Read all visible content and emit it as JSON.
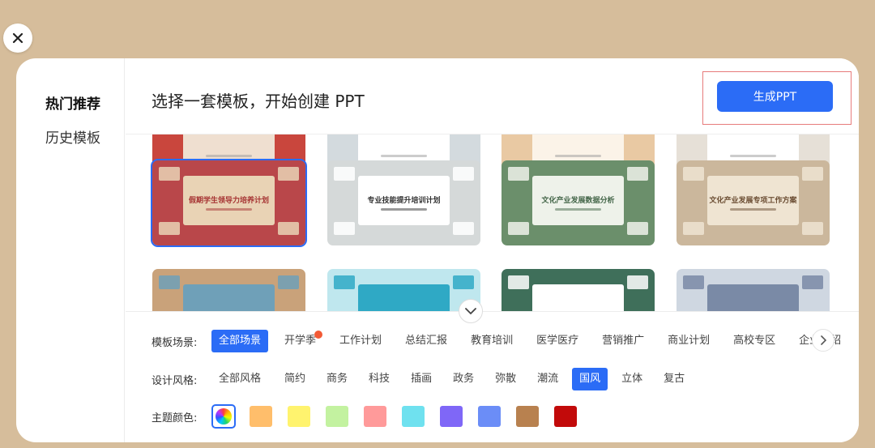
{
  "sidebar": {
    "items": [
      {
        "label": "热门推荐",
        "active": true
      },
      {
        "label": "历史模板",
        "active": false
      }
    ]
  },
  "header": {
    "title": "选择一套模板，开始创建 PPT",
    "generate_label": "生成PPT"
  },
  "templates": {
    "row_top": [
      {
        "bg": "#c9463d",
        "accent": "#efdfd0",
        "title": ""
      },
      {
        "bg": "#d3dade",
        "accent": "#ffffff",
        "title": ""
      },
      {
        "bg": "#e9c9a3",
        "accent": "#fbf3e8",
        "title": ""
      },
      {
        "bg": "#e6e0d7",
        "accent": "#ffffff",
        "title": ""
      }
    ],
    "row_main": [
      {
        "bg": "#b9474a",
        "accent": "#e9d3b5",
        "title": "假期学生领导力培养计划",
        "title_color": "#a63433",
        "selected": true
      },
      {
        "bg": "#d5d9d9",
        "accent": "#ffffff",
        "title": "专业技能提升培训计划",
        "title_color": "#333333",
        "selected": false
      },
      {
        "bg": "#6b8f6b",
        "accent": "#eef2ea",
        "title": "文化产业发展数据分析",
        "title_color": "#45674a",
        "selected": false
      },
      {
        "bg": "#cbb79c",
        "accent": "#efe4d2",
        "title": "文化产业发展专项工作方案",
        "title_color": "#6b4d33",
        "selected": false
      }
    ],
    "row_bottom": [
      {
        "bg": "#c9a27a",
        "accent": "#6fa0b8",
        "title": ""
      },
      {
        "bg": "#bfe7ee",
        "accent": "#2fa9c5",
        "title": ""
      },
      {
        "bg": "#3f6f5a",
        "accent": "#ffffff",
        "title": ""
      },
      {
        "bg": "#cfd7e1",
        "accent": "#7a8aa6",
        "title": ""
      }
    ]
  },
  "filters": {
    "scene": {
      "label": "模板场景:",
      "options": [
        {
          "label": "全部场景",
          "active": true,
          "hot": false
        },
        {
          "label": "开学季",
          "active": false,
          "hot": true
        },
        {
          "label": "工作计划",
          "active": false,
          "hot": false
        },
        {
          "label": "总结汇报",
          "active": false,
          "hot": false
        },
        {
          "label": "教育培训",
          "active": false,
          "hot": false
        },
        {
          "label": "医学医疗",
          "active": false,
          "hot": false
        },
        {
          "label": "营销推广",
          "active": false,
          "hot": false
        },
        {
          "label": "商业计划",
          "active": false,
          "hot": false
        },
        {
          "label": "高校专区",
          "active": false,
          "hot": false
        },
        {
          "label": "企业介绍",
          "active": false,
          "hot": false
        }
      ]
    },
    "style": {
      "label": "设计风格:",
      "options": [
        {
          "label": "全部风格",
          "active": false
        },
        {
          "label": "简约",
          "active": false
        },
        {
          "label": "商务",
          "active": false
        },
        {
          "label": "科技",
          "active": false
        },
        {
          "label": "插画",
          "active": false
        },
        {
          "label": "政务",
          "active": false
        },
        {
          "label": "弥散",
          "active": false
        },
        {
          "label": "潮流",
          "active": false
        },
        {
          "label": "国风",
          "active": true
        },
        {
          "label": "立体",
          "active": false
        },
        {
          "label": "复古",
          "active": false
        }
      ]
    },
    "color": {
      "label": "主题颜色:",
      "swatches": [
        "#ffbe6b",
        "#fff36e",
        "#c3f2a0",
        "#ff9a9a",
        "#6fe1ef",
        "#7f67f7",
        "#6b8df7",
        "#b8814f",
        "#c20a0a"
      ]
    }
  },
  "icons": {
    "close": "close-icon",
    "expand": "chevron-down-icon",
    "next": "chevron-right-icon",
    "all_colors": "color-wheel-icon"
  }
}
